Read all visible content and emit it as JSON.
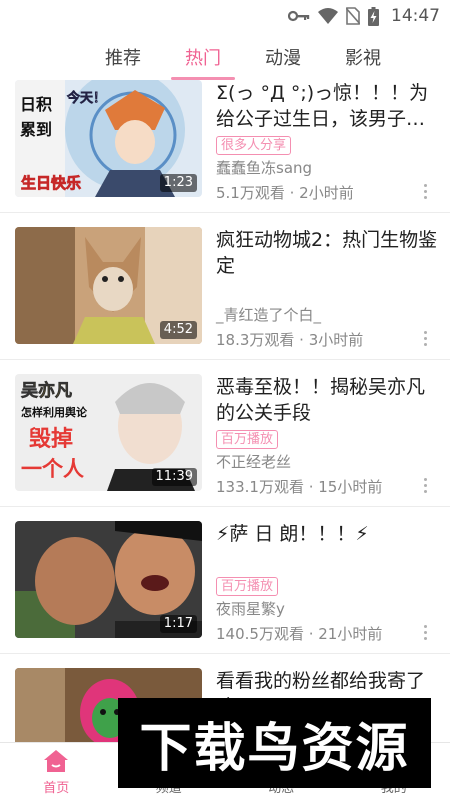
{
  "status_bar": {
    "time": "14:47"
  },
  "tabs": [
    {
      "label": "推荐",
      "active": false
    },
    {
      "label": "热门",
      "active": true
    },
    {
      "label": "动漫",
      "active": false
    },
    {
      "label": "影視",
      "active": false
    }
  ],
  "videos": [
    {
      "title": "Σ(っ °Д °;)っ惊！！！为给公子过生日，该男子…",
      "badge": "很多人分享",
      "author": "蠢蠢鱼冻sang",
      "meta": "5.1万观看 · 2小时前",
      "duration": "1:23",
      "thumb_text": [
        "今天！",
        "生日快乐",
        "日积",
        "累到"
      ]
    },
    {
      "title": "疯狂动物城2：热门生物鉴定",
      "badge": "",
      "author": "_青红造了个白_",
      "meta": "18.3万观看 · 3小时前",
      "duration": "4:52",
      "thumb_text": []
    },
    {
      "title": "恶毒至极！！揭秘吴亦凡的公关手段",
      "badge": "百万播放",
      "author": "不正经老丝",
      "meta": "133.1万观看 · 15小时前",
      "duration": "11:39",
      "thumb_text": [
        "吴亦凡",
        "怎样利用舆论",
        "毁掉",
        "一个人"
      ]
    },
    {
      "title": "⚡萨 日 朗！！！⚡",
      "badge": "百万播放",
      "author": "夜雨星繁y",
      "meta": "140.5万观看 · 21小时前",
      "duration": "1:17",
      "thumb_text": []
    },
    {
      "title": "看看我的粉丝都给我寄了啥！",
      "badge": "",
      "author": "",
      "meta": "",
      "duration": "",
      "thumb_text": []
    }
  ],
  "bottom_nav": [
    {
      "label": "首页",
      "icon": "home-icon",
      "active": true
    },
    {
      "label": "频道",
      "icon": "channel-icon",
      "active": false
    },
    {
      "label": "动态",
      "icon": "activity-icon",
      "active": false
    },
    {
      "label": "我的",
      "icon": "profile-icon",
      "active": false
    }
  ],
  "watermark": "下载鸟资源",
  "colors": {
    "accent": "#f06292",
    "badge": "#f48fb1",
    "meta": "#888888"
  }
}
